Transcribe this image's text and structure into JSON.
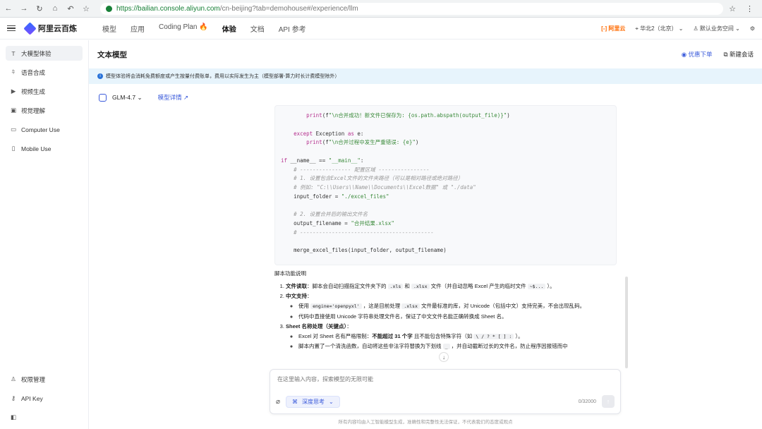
{
  "browser": {
    "url_host": "https://bailian.console.aliyun.com",
    "url_path": "/cn-beijing?tab=demohouse#/experience/llm"
  },
  "topbar": {
    "logo_text": "阿里云百炼",
    "nav": [
      "模型",
      "应用",
      "Coding Plan",
      "体验",
      "文档",
      "API 参考"
    ],
    "active_nav": "体验",
    "brand": "[-] 阿里云",
    "region": "华北2（北京）",
    "workspace": "默认业务空间"
  },
  "sidebar": {
    "items": [
      {
        "label": "大模型体验",
        "icon": "text-icon"
      },
      {
        "label": "语音合成",
        "icon": "audio-icon"
      },
      {
        "label": "视频生成",
        "icon": "video-icon"
      },
      {
        "label": "视觉理解",
        "icon": "image-icon"
      },
      {
        "label": "Computer Use",
        "icon": "monitor-icon"
      },
      {
        "label": "Mobile Use",
        "icon": "mobile-icon"
      }
    ],
    "bottom_items": [
      {
        "label": "权限管理",
        "icon": "user-icon"
      },
      {
        "label": "API Key",
        "icon": "key-icon"
      }
    ]
  },
  "main": {
    "title": "文本模型",
    "actions": {
      "discount": "优惠下单",
      "new_chat": "新建会话"
    },
    "notice": "模型体验将会消耗免费额度或产生按量付费账单，费用以实际发生为主（模型部署-算力时长计费模型除外）",
    "model_name": "GLM-4.7",
    "model_detail": "模型详情"
  },
  "code_lines": [
    {
      "indent": 8,
      "parts": [
        [
          "fn",
          "print"
        ],
        [
          "",
          "(f"
        ],
        [
          "st",
          "\"\\n合并成功！新文件已保存为: {os.path.abspath(output_file)}\""
        ],
        [
          "",
          ")"
        ]
      ]
    },
    {
      "indent": 0,
      "parts": []
    },
    {
      "indent": 4,
      "parts": [
        [
          "kw",
          "except"
        ],
        [
          "",
          " Exception "
        ],
        [
          "kw",
          "as"
        ],
        [
          "",
          " e:"
        ]
      ]
    },
    {
      "indent": 8,
      "parts": [
        [
          "fn",
          "print"
        ],
        [
          "",
          "(f"
        ],
        [
          "st",
          "\"\\n合并过程中发生严重错误: {e}\""
        ],
        [
          "",
          ")"
        ]
      ]
    },
    {
      "indent": 0,
      "parts": []
    },
    {
      "indent": 0,
      "parts": [
        [
          "kw",
          "if"
        ],
        [
          "",
          " __name__ == "
        ],
        [
          "st",
          "\"__main__\""
        ],
        [
          "",
          ":"
        ]
      ]
    },
    {
      "indent": 4,
      "parts": [
        [
          "cm",
          "# ---------------- 配置区域 ----------------"
        ]
      ]
    },
    {
      "indent": 4,
      "parts": [
        [
          "cm",
          "# 1. 设置包含Excel文件的文件夹路径（可以是相对路径或绝对路径）"
        ]
      ]
    },
    {
      "indent": 4,
      "parts": [
        [
          "cm",
          "# 例如: \"C:\\\\Users\\\\Name\\\\Documents\\\\Excel数据\" 或 \"./data\""
        ]
      ]
    },
    {
      "indent": 4,
      "parts": [
        [
          "",
          "input_folder = "
        ],
        [
          "st",
          "\"./excel_files\""
        ]
      ]
    },
    {
      "indent": 0,
      "parts": []
    },
    {
      "indent": 4,
      "parts": [
        [
          "cm",
          "# 2. 设置合并后的输出文件名"
        ]
      ]
    },
    {
      "indent": 4,
      "parts": [
        [
          "",
          "output_filename = "
        ],
        [
          "st",
          "\"合并结果.xlsx\""
        ]
      ]
    },
    {
      "indent": 4,
      "parts": [
        [
          "cm",
          "# ------------------------------------------"
        ]
      ]
    },
    {
      "indent": 0,
      "parts": []
    },
    {
      "indent": 4,
      "parts": [
        [
          "",
          "merge_excel_files(input_folder, output_filename)"
        ]
      ]
    }
  ],
  "explain": {
    "heading": "脚本功能说明",
    "item1_title": "文件读取",
    "item1_a": "：脚本会自动扫描指定文件夹下的",
    "item1_xls": ".xls",
    "item1_and": "和",
    "item1_xlsx": ".xlsx",
    "item1_b": "文件（并自动忽略 Excel 产生的临时文件",
    "item1_tmp": "~$...",
    "item1_c": "）。",
    "item2_title": "中文支持",
    "item2_colon": "：",
    "item2_b1_pre": "使用",
    "item2_b1_code": "engine='openpyxl'",
    "item2_b1_mid": "，这是目前处理",
    "item2_b1_code2": ".xlsx",
    "item2_b1_post": "文件最标准的库，对 Unicode（包括中文）支持完美，不会出现乱码。",
    "item2_b2": "代码中直接使用 Unicode 字符串处理文件名，保证了中文文件名能正确转换成 Sheet 名。",
    "item3_title": "Sheet 名称处理（关键点）",
    "item3_colon": "：",
    "item3_b1_pre": "Excel 对 Sheet 名有严格限制：",
    "item3_b1_bold": "不能超过 31 个字",
    "item3_b1_mid": "且不能包含特殊字符",
    "item3_b1_paren": "（如",
    "item3_b1_code": "\\ / ? * [ ] :",
    "item3_b1_end": "）。",
    "item3_b2_pre": "脚本内置了一个清洗函数，自动将这些非法字符替换为下划线",
    "item3_b2_code": "_",
    "item3_b2_post": "，并自动截断过长的文件名，防止程序因报错而中"
  },
  "input": {
    "placeholder": "在这里输入内容，探索模型的无限可能",
    "deep_think": "深度思考",
    "counter": "0/32000"
  },
  "footer": "所有内容均由人工智能模型生成，准确性和完整性无法保证，不代表我们的态度或观点"
}
